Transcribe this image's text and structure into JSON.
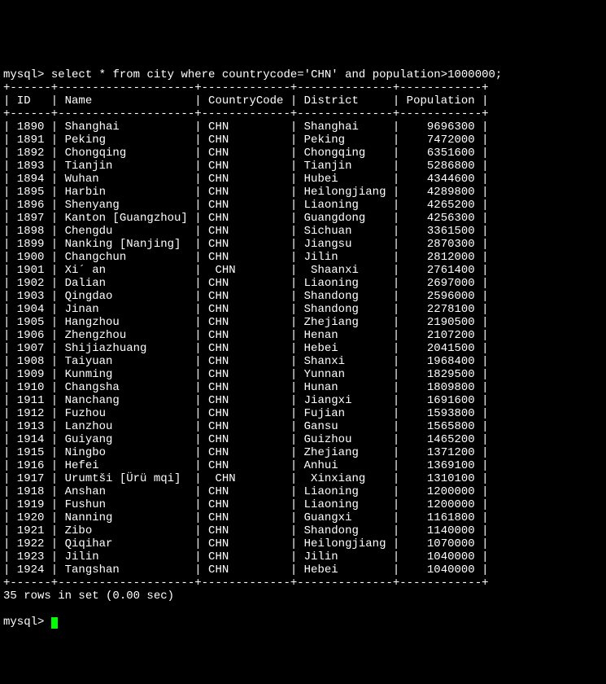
{
  "prompt": "mysql>",
  "query": "select * from city where countrycode='CHN' and population>1000000;",
  "columns": [
    "ID",
    "Name",
    "CountryCode",
    "District",
    "Population"
  ],
  "rows": [
    {
      "id": 1890,
      "name": "Shanghai",
      "code": "CHN",
      "district": "Shanghai",
      "pop": 9696300,
      "special": false
    },
    {
      "id": 1891,
      "name": "Peking",
      "code": "CHN",
      "district": "Peking",
      "pop": 7472000,
      "special": false
    },
    {
      "id": 1892,
      "name": "Chongqing",
      "code": "CHN",
      "district": "Chongqing",
      "pop": 6351600,
      "special": false
    },
    {
      "id": 1893,
      "name": "Tianjin",
      "code": "CHN",
      "district": "Tianjin",
      "pop": 5286800,
      "special": false
    },
    {
      "id": 1894,
      "name": "Wuhan",
      "code": "CHN",
      "district": "Hubei",
      "pop": 4344600,
      "special": false
    },
    {
      "id": 1895,
      "name": "Harbin",
      "code": "CHN",
      "district": "Heilongjiang",
      "pop": 4289800,
      "special": false
    },
    {
      "id": 1896,
      "name": "Shenyang",
      "code": "CHN",
      "district": "Liaoning",
      "pop": 4265200,
      "special": false
    },
    {
      "id": 1897,
      "name": "Kanton [Guangzhou]",
      "code": "CHN",
      "district": "Guangdong",
      "pop": 4256300,
      "special": false
    },
    {
      "id": 1898,
      "name": "Chengdu",
      "code": "CHN",
      "district": "Sichuan",
      "pop": 3361500,
      "special": false
    },
    {
      "id": 1899,
      "name": "Nanking [Nanjing]",
      "code": "CHN",
      "district": "Jiangsu",
      "pop": 2870300,
      "special": false
    },
    {
      "id": 1900,
      "name": "Changchun",
      "code": "CHN",
      "district": "Jilin",
      "pop": 2812000,
      "special": false
    },
    {
      "id": 1901,
      "name": "Xi´ an",
      "code": "CHN",
      "district": "Shaanxi",
      "pop": 2761400,
      "special": true
    },
    {
      "id": 1902,
      "name": "Dalian",
      "code": "CHN",
      "district": "Liaoning",
      "pop": 2697000,
      "special": false
    },
    {
      "id": 1903,
      "name": "Qingdao",
      "code": "CHN",
      "district": "Shandong",
      "pop": 2596000,
      "special": false
    },
    {
      "id": 1904,
      "name": "Jinan",
      "code": "CHN",
      "district": "Shandong",
      "pop": 2278100,
      "special": false
    },
    {
      "id": 1905,
      "name": "Hangzhou",
      "code": "CHN",
      "district": "Zhejiang",
      "pop": 2190500,
      "special": false
    },
    {
      "id": 1906,
      "name": "Zhengzhou",
      "code": "CHN",
      "district": "Henan",
      "pop": 2107200,
      "special": false
    },
    {
      "id": 1907,
      "name": "Shijiazhuang",
      "code": "CHN",
      "district": "Hebei",
      "pop": 2041500,
      "special": false
    },
    {
      "id": 1908,
      "name": "Taiyuan",
      "code": "CHN",
      "district": "Shanxi",
      "pop": 1968400,
      "special": false
    },
    {
      "id": 1909,
      "name": "Kunming",
      "code": "CHN",
      "district": "Yunnan",
      "pop": 1829500,
      "special": false
    },
    {
      "id": 1910,
      "name": "Changsha",
      "code": "CHN",
      "district": "Hunan",
      "pop": 1809800,
      "special": false
    },
    {
      "id": 1911,
      "name": "Nanchang",
      "code": "CHN",
      "district": "Jiangxi",
      "pop": 1691600,
      "special": false
    },
    {
      "id": 1912,
      "name": "Fuzhou",
      "code": "CHN",
      "district": "Fujian",
      "pop": 1593800,
      "special": false
    },
    {
      "id": 1913,
      "name": "Lanzhou",
      "code": "CHN",
      "district": "Gansu",
      "pop": 1565800,
      "special": false
    },
    {
      "id": 1914,
      "name": "Guiyang",
      "code": "CHN",
      "district": "Guizhou",
      "pop": 1465200,
      "special": false
    },
    {
      "id": 1915,
      "name": "Ningbo",
      "code": "CHN",
      "district": "Zhejiang",
      "pop": 1371200,
      "special": false
    },
    {
      "id": 1916,
      "name": "Hefei",
      "code": "CHN",
      "district": "Anhui",
      "pop": 1369100,
      "special": false
    },
    {
      "id": 1917,
      "name": "Urumtši [Ürü mqi]",
      "code": "CHN",
      "district": "Xinxiang",
      "pop": 1310100,
      "special": true
    },
    {
      "id": 1918,
      "name": "Anshan",
      "code": "CHN",
      "district": "Liaoning",
      "pop": 1200000,
      "special": false
    },
    {
      "id": 1919,
      "name": "Fushun",
      "code": "CHN",
      "district": "Liaoning",
      "pop": 1200000,
      "special": false
    },
    {
      "id": 1920,
      "name": "Nanning",
      "code": "CHN",
      "district": "Guangxi",
      "pop": 1161800,
      "special": false
    },
    {
      "id": 1921,
      "name": "Zibo",
      "code": "CHN",
      "district": "Shandong",
      "pop": 1140000,
      "special": false
    },
    {
      "id": 1922,
      "name": "Qiqihar",
      "code": "CHN",
      "district": "Heilongjiang",
      "pop": 1070000,
      "special": false
    },
    {
      "id": 1923,
      "name": "Jilin",
      "code": "CHN",
      "district": "Jilin",
      "pop": 1040000,
      "special": false
    },
    {
      "id": 1924,
      "name": "Tangshan",
      "code": "CHN",
      "district": "Hebei",
      "pop": 1040000,
      "special": false
    }
  ],
  "footer": "35 rows in set (0.00 sec)",
  "border": "+------+--------------------+-------------+--------------+------------+"
}
